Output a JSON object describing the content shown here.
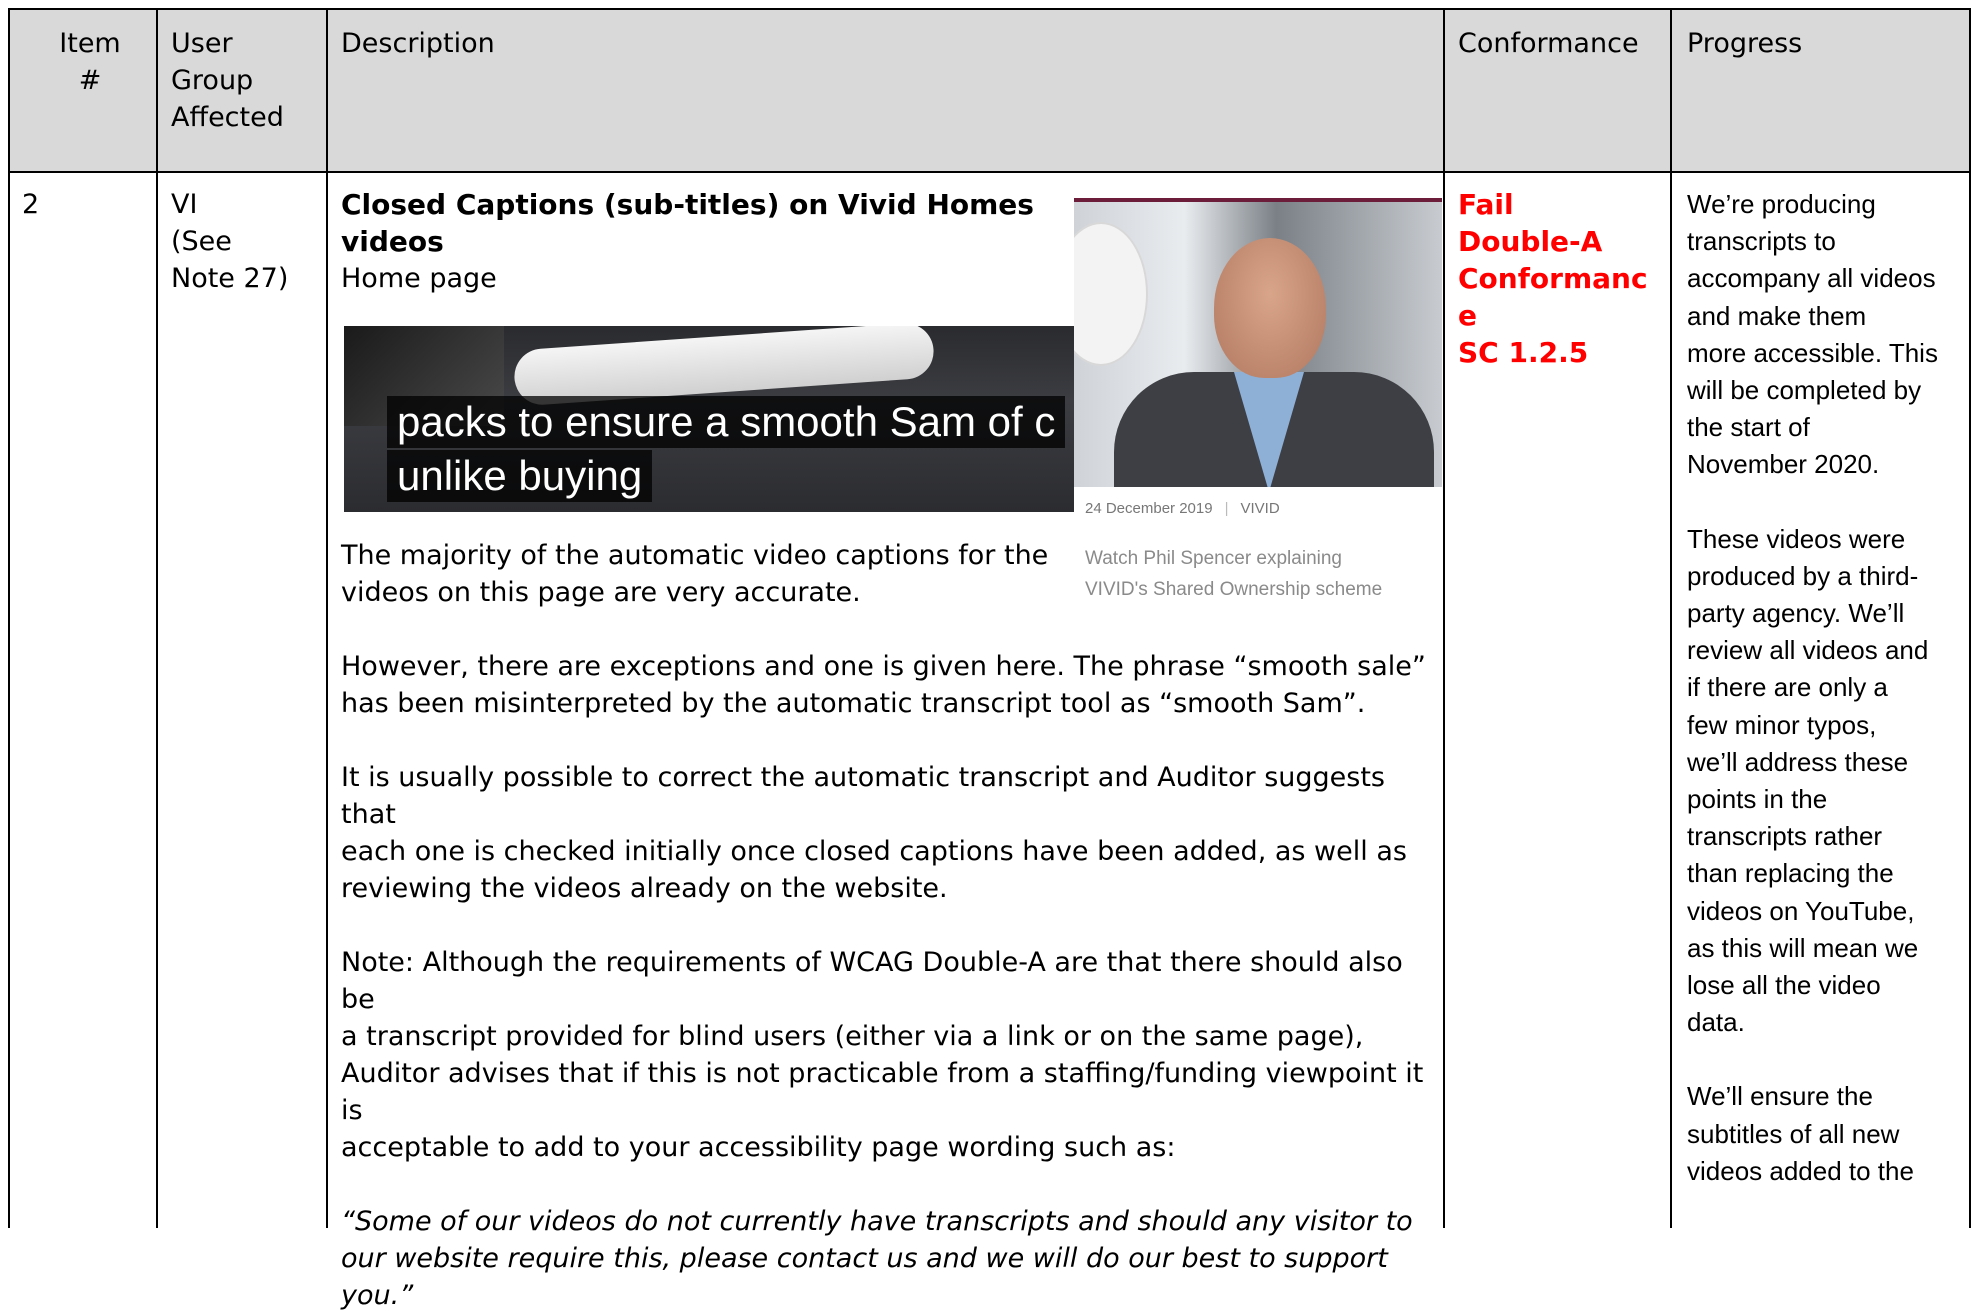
{
  "header": {
    "col1": [
      "Item",
      "#"
    ],
    "col2": [
      "User",
      "Group",
      "Affected"
    ],
    "col3": "Description",
    "col4": "Conformance",
    "col5": "Progress"
  },
  "row": {
    "item": "2",
    "user_group": [
      "VI",
      "(See",
      "Note 27)"
    ],
    "description": {
      "title": [
        "Closed Captions (sub-titles) on Vivid Homes",
        "videos"
      ],
      "subtitle": "Home page",
      "caption_image": {
        "lines": [
          "packs to ensure a smooth Sam of c",
          "unlike buying"
        ]
      },
      "thumbnail": {
        "date": "24 December 2019",
        "brand": "VIVID",
        "caption": [
          "Watch Phil Spencer explaining",
          "VIVID's Shared Ownership scheme"
        ]
      },
      "para1": [
        "The majority of the automatic video captions for the",
        "videos on this page are very accurate."
      ],
      "para2": [
        "However, there are exceptions and one is given here. The phrase “smooth sale”",
        "has been misinterpreted by the automatic transcript tool as “smooth Sam”."
      ],
      "para3": [
        "It is usually possible to correct the automatic transcript and Auditor suggests that",
        "each one is checked initially once closed captions have been added, as well as",
        "reviewing the videos already on the website."
      ],
      "para4": [
        "Note: Although the requirements of WCAG Double-A are that there should also be",
        "a transcript provided for blind users (either via a link or on the same page),",
        "Auditor advises that if this is not practicable from a staffing/funding viewpoint it is",
        "acceptable to add to your accessibility page wording such as:"
      ],
      "quote": [
        "“Some of our videos do not currently have transcripts and should any visitor to",
        "our website require this, please contact us and we will do our best to support",
        "you.”"
      ]
    },
    "conformance": [
      "Fail",
      "Double-A",
      "Conformanc",
      "e",
      "SC 1.2.5"
    ],
    "progress": {
      "p1": [
        "We’re producing",
        "transcripts to",
        "accompany all videos",
        "and make them",
        "more accessible. This",
        "will be completed by",
        "the start of",
        "November 2020."
      ],
      "p2": [
        "These videos were",
        "produced by a third-",
        "party agency. We’ll",
        "review all videos and",
        "if there are only a",
        "few minor typos,",
        "we’ll address these",
        "points in the",
        "transcripts rather",
        "than replacing the",
        "videos on YouTube,",
        "as this will mean we",
        "lose all the video",
        "data."
      ],
      "p3": [
        "We’ll ensure the",
        "subtitles of all new",
        "videos added to the"
      ]
    }
  },
  "colors": {
    "header_bg": "#d9d9d9",
    "fail_red": "#ff0000"
  }
}
